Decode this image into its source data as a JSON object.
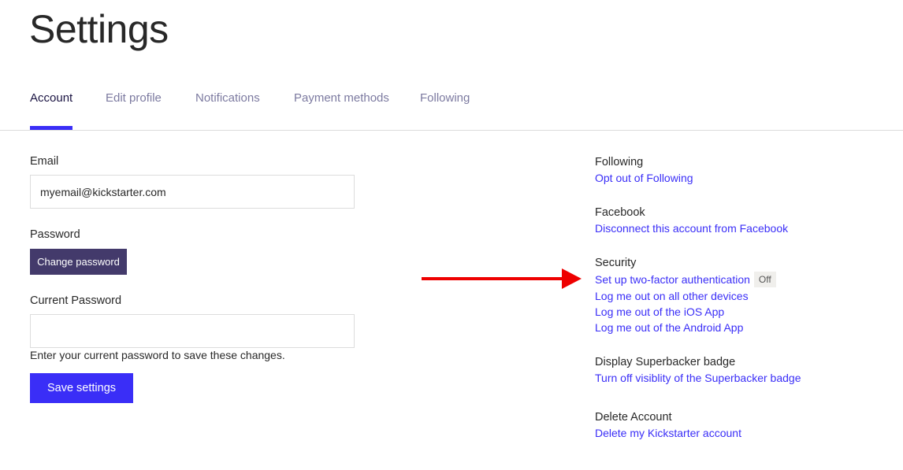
{
  "page": {
    "title": "Settings"
  },
  "tabs": [
    {
      "label": "Account",
      "active": true
    },
    {
      "label": "Edit profile",
      "active": false
    },
    {
      "label": "Notifications",
      "active": false
    },
    {
      "label": "Payment methods",
      "active": false
    },
    {
      "label": "Following",
      "active": false
    }
  ],
  "form": {
    "email_label": "Email",
    "email_value": "myemail@kickstarter.com",
    "password_label": "Password",
    "change_password_label": "Change password",
    "current_password_label": "Current Password",
    "current_password_value": "",
    "help_text": "Enter your current password to save these changes.",
    "save_label": "Save settings"
  },
  "sidebar": {
    "following": {
      "heading": "Following",
      "link": "Opt out of Following"
    },
    "facebook": {
      "heading": "Facebook",
      "link": "Disconnect this account from Facebook"
    },
    "security": {
      "heading": "Security",
      "two_factor_link": "Set up two-factor authentication",
      "two_factor_status": "Off",
      "links": [
        "Log me out on all other devices",
        "Log me out of the iOS App",
        "Log me out of the Android App"
      ]
    },
    "superbacker": {
      "heading": "Display Superbacker badge",
      "link": "Turn off visiblity of the Superbacker badge"
    },
    "delete": {
      "heading": "Delete Account",
      "link": "Delete my Kickstarter account"
    }
  },
  "annotation": {
    "arrow_color": "#ee0000",
    "points_to": "Set up two-factor authentication"
  },
  "colors": {
    "accent": "#3a2ef7",
    "secondary_button": "#433a6b",
    "tab_inactive": "#7c7aa0"
  }
}
